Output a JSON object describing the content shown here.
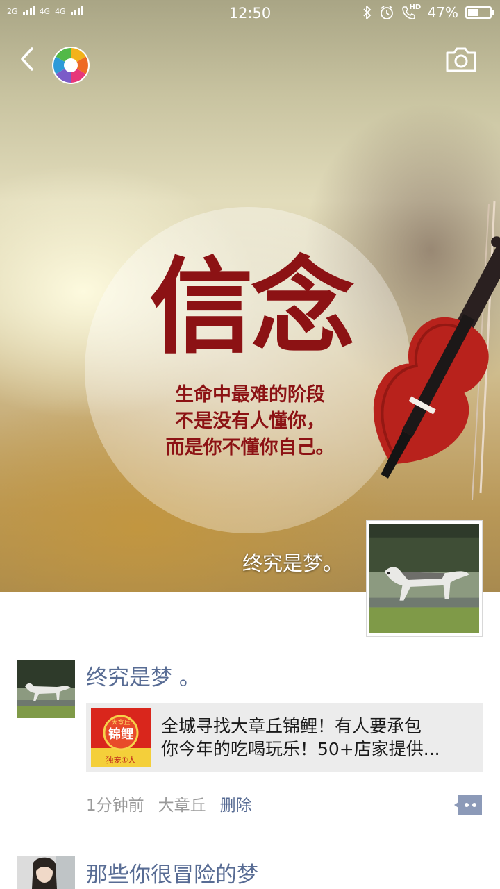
{
  "status_bar": {
    "network_1": "2G",
    "network_2": "4G",
    "network_3": "4G",
    "time": "12:50",
    "icons": [
      "bluetooth-icon",
      "alarm-icon",
      "hd-call-icon",
      "battery-icon"
    ],
    "battery_percent": "47%",
    "battery_level": 0.47,
    "hd_label": "HD"
  },
  "header": {
    "back_icon": "chevron-left-icon",
    "logo_icon": "moments-aperture-icon",
    "camera_icon": "camera-icon"
  },
  "cover": {
    "title": "信念",
    "lines": [
      "生命中最难的阶段",
      "不是没有人懂你，",
      "而是你不懂你自己。"
    ],
    "user_name": "终究是梦。"
  },
  "posts": [
    {
      "author": "终究是梦 。",
      "link": {
        "thumb_title_1": "大章丘",
        "thumb_title_2": "锦鲤",
        "thumb_caption": "独宠①人",
        "text_line_1": "全城寻找大章丘锦鲤！有人要承包",
        "text_line_2": "你今年的吃喝玩乐！50+店家提供..."
      },
      "time": "1分钟前",
      "location": "大章丘",
      "delete_label": "删除",
      "more_icon": "comment-more-icon"
    },
    {
      "author": "那些你很冒险的梦"
    }
  ],
  "colors": {
    "link_blue": "#586c94",
    "meta_gray": "#9a9a9a",
    "card_bg": "#ececec",
    "cover_red": "#8c1214"
  }
}
